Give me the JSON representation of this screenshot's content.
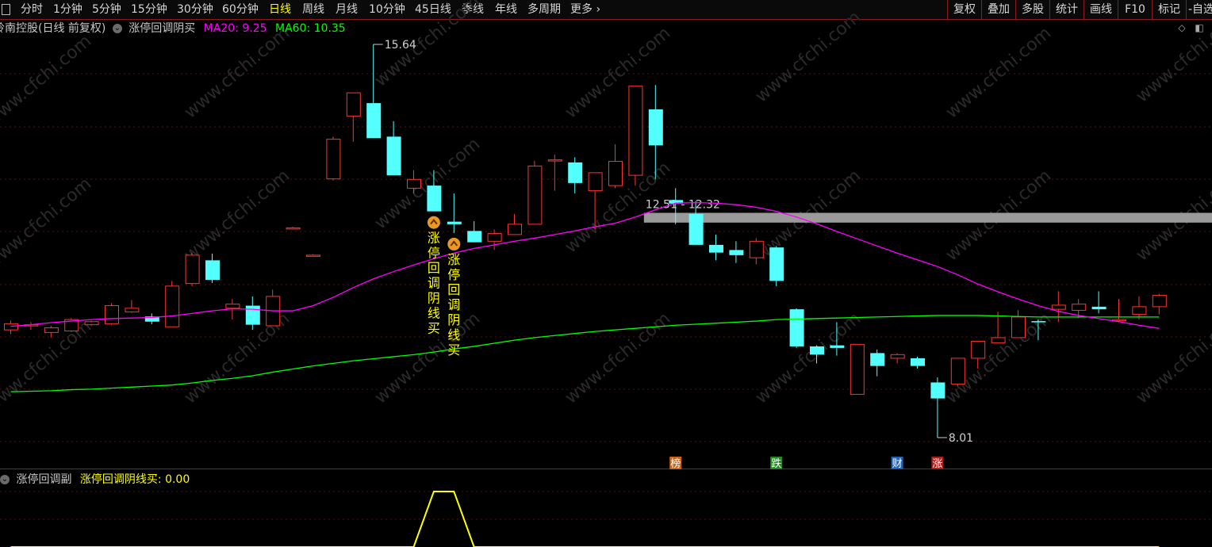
{
  "toolbar": {
    "left_icon": "window-icon",
    "periods": [
      {
        "label": "分时",
        "active": false
      },
      {
        "label": "1分钟",
        "active": false
      },
      {
        "label": "5分钟",
        "active": false
      },
      {
        "label": "15分钟",
        "active": false
      },
      {
        "label": "30分钟",
        "active": false
      },
      {
        "label": "60分钟",
        "active": false
      },
      {
        "label": "日线",
        "active": true
      },
      {
        "label": "周线",
        "active": false
      },
      {
        "label": "月线",
        "active": false
      },
      {
        "label": "10分钟",
        "active": false
      },
      {
        "label": "45日线",
        "active": false
      },
      {
        "label": "季线",
        "active": false
      },
      {
        "label": "年线",
        "active": false
      },
      {
        "label": "多周期",
        "active": false
      },
      {
        "label": "更多",
        "active": false
      }
    ],
    "more_icon": "chevron-right-icon",
    "right_buttons": [
      "复权",
      "叠加",
      "多股",
      "统计",
      "画线",
      "F10",
      "标记",
      "-自选"
    ]
  },
  "info": {
    "stock": "岭南控股(日线 前复权)",
    "indicator": "涨停回调阴买",
    "ma20_label": "MA20: 9.25",
    "ma60_label": "MA60: 10.35",
    "ma20_color": "#ff00ff",
    "ma60_color": "#00ff00"
  },
  "sub": {
    "name": "涨停回调副",
    "value_label": "涨停回调阴线买: 0.00",
    "line_color": "#ffff00"
  },
  "annotations": {
    "high": "15.64",
    "low": "8.01",
    "range": "12.51 - 12.32",
    "signal_text": "涨停回调阴线买",
    "tags": [
      {
        "text": "榜",
        "color": "#c86418"
      },
      {
        "text": "跌",
        "color": "#1e8c1e"
      },
      {
        "text": "财",
        "color": "#2460b0"
      },
      {
        "text": "涨",
        "color": "#b01c1c"
      }
    ]
  },
  "watermark": "www.cfchi.com",
  "chart_data": {
    "type": "candlestick",
    "ohlc_note": "daily bars, open/high/low/close in price units",
    "candles": [
      {
        "o": 10.1,
        "h": 10.28,
        "l": 10.02,
        "c": 10.22
      },
      {
        "o": 10.2,
        "h": 10.25,
        "l": 10.1,
        "c": 10.2
      },
      {
        "o": 10.05,
        "h": 10.18,
        "l": 9.95,
        "c": 10.14
      },
      {
        "o": 10.08,
        "h": 10.33,
        "l": 10.06,
        "c": 10.3
      },
      {
        "o": 10.2,
        "h": 10.28,
        "l": 10.18,
        "c": 10.26
      },
      {
        "o": 10.22,
        "h": 10.62,
        "l": 10.2,
        "c": 10.57
      },
      {
        "o": 10.45,
        "h": 10.68,
        "l": 10.43,
        "c": 10.52
      },
      {
        "o": 10.36,
        "h": 10.42,
        "l": 10.21,
        "c": 10.26
      },
      {
        "o": 10.16,
        "h": 11.05,
        "l": 10.16,
        "c": 10.95
      },
      {
        "o": 11.0,
        "h": 11.6,
        "l": 10.95,
        "c": 11.55
      },
      {
        "o": 11.45,
        "h": 11.58,
        "l": 11.01,
        "c": 11.07
      },
      {
        "o": 10.52,
        "h": 10.7,
        "l": 10.3,
        "c": 10.6
      },
      {
        "o": 10.57,
        "h": 10.75,
        "l": 10.1,
        "c": 10.2
      },
      {
        "o": 10.18,
        "h": 10.88,
        "l": 10.18,
        "c": 10.75
      },
      {
        "o": 12.08,
        "h": 12.1,
        "l": 12.07,
        "c": 12.08
      },
      {
        "o": 11.55,
        "h": 11.57,
        "l": 11.54,
        "c": 11.55
      },
      {
        "o": 13.03,
        "h": 13.85,
        "l": 13.0,
        "c": 13.8
      },
      {
        "o": 14.25,
        "h": 14.7,
        "l": 13.75,
        "c": 14.7
      },
      {
        "o": 14.5,
        "h": 15.64,
        "l": 13.82,
        "c": 13.82
      },
      {
        "o": 13.85,
        "h": 14.15,
        "l": 13.1,
        "c": 13.1
      },
      {
        "o": 12.85,
        "h": 13.2,
        "l": 12.75,
        "c": 13.02
      },
      {
        "o": 12.9,
        "h": 13.2,
        "l": 12.4,
        "c": 12.4
      },
      {
        "o": 12.2,
        "h": 12.75,
        "l": 11.98,
        "c": 12.15
      },
      {
        "o": 12.02,
        "h": 12.21,
        "l": 11.82,
        "c": 11.8
      },
      {
        "o": 11.82,
        "h": 12.05,
        "l": 11.65,
        "c": 11.97
      },
      {
        "o": 11.95,
        "h": 12.35,
        "l": 11.95,
        "c": 12.15
      },
      {
        "o": 12.15,
        "h": 13.38,
        "l": 12.15,
        "c": 13.28
      },
      {
        "o": 13.4,
        "h": 13.5,
        "l": 12.8,
        "c": 13.4
      },
      {
        "o": 13.35,
        "h": 13.45,
        "l": 12.75,
        "c": 12.95
      },
      {
        "o": 12.8,
        "h": 13.15,
        "l": 12.05,
        "c": 13.15
      },
      {
        "o": 12.9,
        "h": 13.7,
        "l": 12.85,
        "c": 13.37
      },
      {
        "o": 13.1,
        "h": 14.83,
        "l": 12.9,
        "c": 14.83
      },
      {
        "o": 14.38,
        "h": 14.85,
        "l": 13.02,
        "c": 13.68
      },
      {
        "o": 12.62,
        "h": 12.85,
        "l": 12.15,
        "c": 12.55
      },
      {
        "o": 12.35,
        "h": 12.6,
        "l": 11.75,
        "c": 11.75
      },
      {
        "o": 11.75,
        "h": 11.95,
        "l": 11.45,
        "c": 11.6
      },
      {
        "o": 11.65,
        "h": 11.82,
        "l": 11.4,
        "c": 11.55
      },
      {
        "o": 11.5,
        "h": 11.88,
        "l": 11.37,
        "c": 11.82
      },
      {
        "o": 11.7,
        "h": 11.73,
        "l": 10.95,
        "c": 11.05
      },
      {
        "o": 10.5,
        "h": 10.52,
        "l": 9.75,
        "c": 9.78
      },
      {
        "o": 9.78,
        "h": 9.8,
        "l": 9.45,
        "c": 9.62
      },
      {
        "o": 9.8,
        "h": 10.25,
        "l": 9.6,
        "c": 9.75
      },
      {
        "o": 8.85,
        "h": 9.8,
        "l": 8.85,
        "c": 9.82
      },
      {
        "o": 9.65,
        "h": 9.72,
        "l": 9.2,
        "c": 9.4
      },
      {
        "o": 9.55,
        "h": 9.65,
        "l": 9.45,
        "c": 9.62
      },
      {
        "o": 9.55,
        "h": 9.58,
        "l": 9.35,
        "c": 9.4
      },
      {
        "o": 9.08,
        "h": 9.18,
        "l": 8.01,
        "c": 8.77
      },
      {
        "o": 9.05,
        "h": 9.55,
        "l": 9.0,
        "c": 9.55
      },
      {
        "o": 9.55,
        "h": 9.88,
        "l": 9.35,
        "c": 9.88
      },
      {
        "o": 9.85,
        "h": 10.45,
        "l": 9.85,
        "c": 9.95
      },
      {
        "o": 9.95,
        "h": 10.48,
        "l": 9.95,
        "c": 10.35
      },
      {
        "o": 10.27,
        "h": 10.3,
        "l": 9.9,
        "c": 10.25
      },
      {
        "o": 10.5,
        "h": 10.85,
        "l": 10.25,
        "c": 10.58
      },
      {
        "o": 10.48,
        "h": 10.7,
        "l": 10.33,
        "c": 10.6
      },
      {
        "o": 10.55,
        "h": 10.85,
        "l": 10.42,
        "c": 10.5
      },
      {
        "o": 10.3,
        "h": 10.7,
        "l": 10.25,
        "c": 10.3
      },
      {
        "o": 10.4,
        "h": 10.75,
        "l": 10.3,
        "c": 10.55
      },
      {
        "o": 10.55,
        "h": 10.8,
        "l": 10.4,
        "c": 10.77
      }
    ],
    "ma20": [
      10.17,
      10.2,
      10.24,
      10.27,
      10.3,
      10.32,
      10.33,
      10.34,
      10.37,
      10.42,
      10.47,
      10.51,
      10.5,
      10.47,
      10.47,
      10.57,
      10.73,
      10.92,
      11.09,
      11.23,
      11.36,
      11.48,
      11.59,
      11.68,
      11.75,
      11.82,
      11.88,
      11.95,
      12.02,
      12.1,
      12.17,
      12.29,
      12.43,
      12.56,
      12.57,
      12.56,
      12.53,
      12.48,
      12.4,
      12.29,
      12.16,
      12.01,
      11.87,
      11.73,
      11.59,
      11.46,
      11.33,
      11.17,
      10.99,
      10.84,
      10.7,
      10.57,
      10.46,
      10.38,
      10.32,
      10.26,
      10.19,
      10.13
    ],
    "ma60": [
      8.9,
      8.91,
      8.92,
      8.94,
      8.95,
      8.97,
      8.99,
      9.01,
      9.03,
      9.07,
      9.12,
      9.16,
      9.21,
      9.28,
      9.34,
      9.4,
      9.45,
      9.5,
      9.54,
      9.58,
      9.62,
      9.67,
      9.73,
      9.78,
      9.84,
      9.9,
      9.95,
      9.99,
      10.03,
      10.07,
      10.1,
      10.13,
      10.16,
      10.19,
      10.21,
      10.23,
      10.25,
      10.27,
      10.3,
      10.31,
      10.32,
      10.33,
      10.34,
      10.35,
      10.36,
      10.37,
      10.38,
      10.38,
      10.38,
      10.37,
      10.36,
      10.35,
      10.35,
      10.35,
      10.35,
      10.35,
      10.35,
      10.35
    ],
    "signal_bars": [
      21,
      22
    ],
    "tag_bars": [
      33,
      38,
      44,
      46
    ],
    "resistance_zone": [
      12.32,
      12.51
    ],
    "sub_signal": [
      0,
      0,
      0,
      0,
      0,
      0,
      0,
      0,
      0,
      0,
      0,
      0,
      0,
      0,
      0,
      0,
      0,
      0,
      0,
      0,
      0,
      1,
      1,
      0,
      0,
      0,
      0,
      0,
      0,
      0,
      0,
      0,
      0,
      0,
      0,
      0,
      0,
      0,
      0,
      0,
      0,
      0,
      0,
      0,
      0,
      0,
      0,
      0,
      0,
      0,
      0,
      0,
      0,
      0,
      0,
      0,
      0,
      0
    ]
  }
}
